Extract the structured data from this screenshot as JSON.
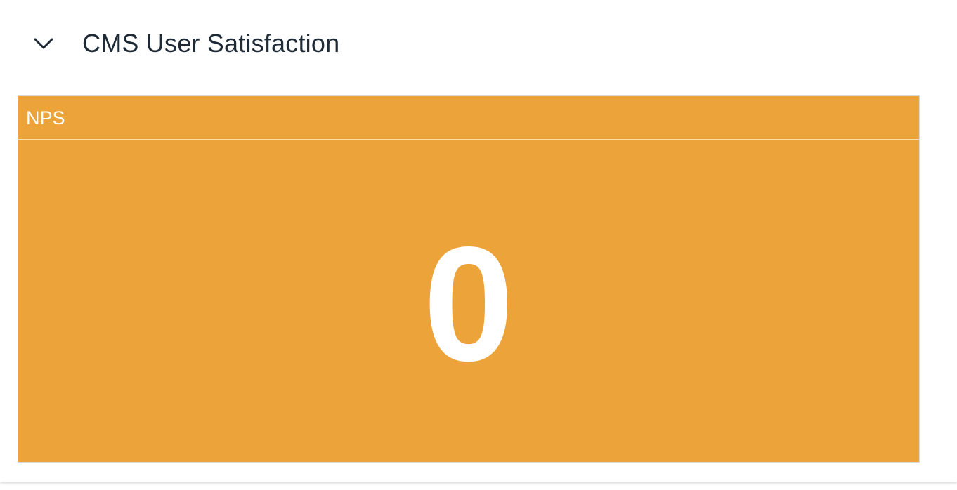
{
  "section": {
    "title": "CMS User Satisfaction",
    "toggle_icon": "chevron-down-icon"
  },
  "tile": {
    "title": "NPS",
    "value": "0",
    "background_color": "#EBA33A"
  }
}
